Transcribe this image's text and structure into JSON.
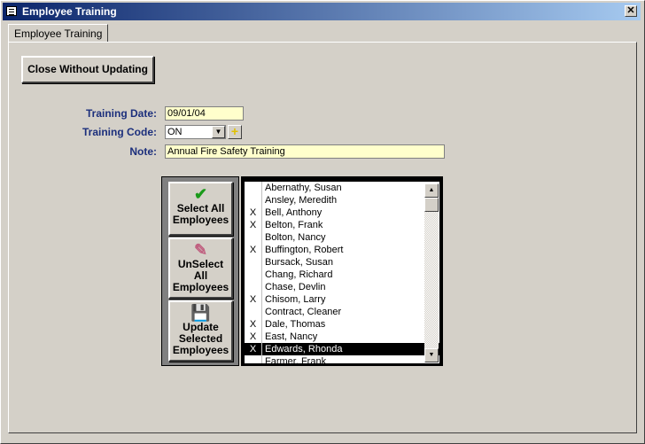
{
  "window": {
    "title": "Employee Training",
    "close_glyph": "✕"
  },
  "tab": {
    "label": "Employee Training"
  },
  "buttons": {
    "close_without_updating": "Close Without Updating",
    "select_all": "Select All Employees",
    "unselect_all": "UnSelect All Employees",
    "update_selected": "Update Selected Employees"
  },
  "form": {
    "training_date_label": "Training Date:",
    "training_date": "09/01/04",
    "training_code_label": "Training Code:",
    "training_code": "ON",
    "note_label": "Note:",
    "note": "Annual Fire Safety Training"
  },
  "employees": [
    {
      "name": "Abernathy, Susan",
      "checked": ""
    },
    {
      "name": "Ansley, Meredith",
      "checked": ""
    },
    {
      "name": "Bell, Anthony",
      "checked": "X"
    },
    {
      "name": "Belton, Frank",
      "checked": "X"
    },
    {
      "name": "Bolton, Nancy",
      "checked": ""
    },
    {
      "name": "Buffington, Robert",
      "checked": "X"
    },
    {
      "name": "Bursack, Susan",
      "checked": ""
    },
    {
      "name": "Chang, Richard",
      "checked": ""
    },
    {
      "name": "Chase, Devlin",
      "checked": ""
    },
    {
      "name": "Chisom, Larry",
      "checked": "X"
    },
    {
      "name": "Contract, Cleaner",
      "checked": ""
    },
    {
      "name": "Dale, Thomas",
      "checked": "X"
    },
    {
      "name": "East, Nancy",
      "checked": "X"
    },
    {
      "name": "Edwards, Rhonda",
      "checked": "X",
      "selected": true
    },
    {
      "name": "Farmer, Frank",
      "checked": ""
    }
  ],
  "icons": {
    "window": "form-icon",
    "select_all": "green-checkmark-icon",
    "unselect_all": "pencil-eraser-icon",
    "update": "floppy-disk-pencil-icon",
    "add_code": "plus-icon"
  }
}
